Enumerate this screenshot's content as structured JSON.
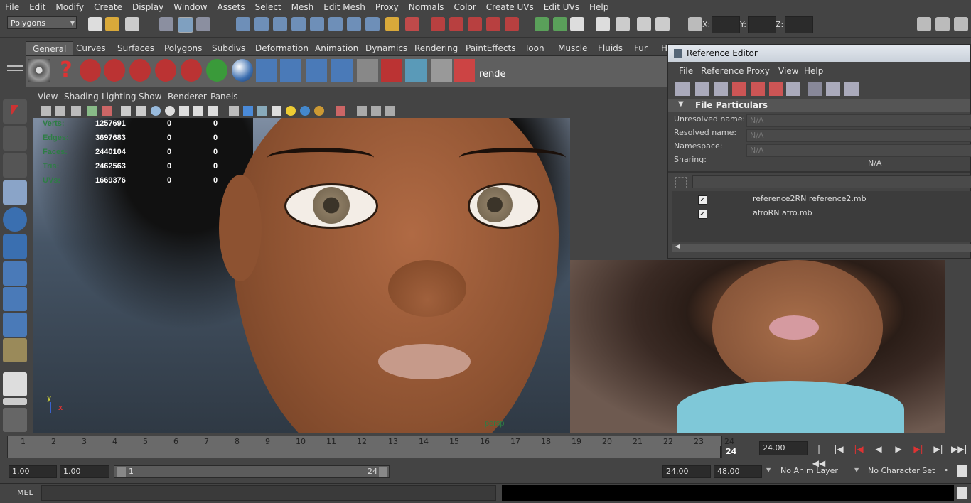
{
  "menubar": {
    "items": [
      "File",
      "Edit",
      "Modify",
      "Create",
      "Display",
      "Window",
      "Assets",
      "Select",
      "Mesh",
      "Edit Mesh",
      "Proxy",
      "Normals",
      "Color",
      "Create UVs",
      "Edit UVs",
      "Help"
    ]
  },
  "statusline": {
    "mode": "Polygons",
    "x_label": "X:",
    "y_label": "Y:",
    "z_label": "Z:"
  },
  "shelf": {
    "tabs": [
      "General",
      "Curves",
      "Surfaces",
      "Polygons",
      "Subdivs",
      "Deformation",
      "Animation",
      "Dynamics",
      "Rendering",
      "PaintEffects",
      "Toon",
      "Muscle",
      "Fluids",
      "Fur",
      "H"
    ],
    "active_tab": "General",
    "render_label": "rende"
  },
  "viewport": {
    "menu": [
      "View",
      "Shading",
      "Lighting",
      "Show",
      "Renderer",
      "Panels"
    ],
    "hud": [
      {
        "label": "Verts:",
        "values": [
          "1257691",
          "0",
          "0"
        ]
      },
      {
        "label": "Edges:",
        "values": [
          "3697683",
          "0",
          "0"
        ]
      },
      {
        "label": "Faces:",
        "values": [
          "2440104",
          "0",
          "0"
        ]
      },
      {
        "label": "Tris:",
        "values": [
          "2462563",
          "0",
          "0"
        ]
      },
      {
        "label": "UVs:",
        "values": [
          "1669376",
          "0",
          "0"
        ]
      }
    ],
    "camera": "persp",
    "axis_y": "y",
    "axis_x": "x"
  },
  "reference_editor": {
    "title": "Reference Editor",
    "menu": [
      "File",
      "Reference",
      "Proxy",
      "View",
      "Help"
    ],
    "section": "File Particulars",
    "fields": [
      {
        "label": "Unresolved name:",
        "value": "N/A"
      },
      {
        "label": "Resolved name:",
        "value": "N/A"
      },
      {
        "label": "Namespace:",
        "value": "N/A"
      }
    ],
    "sharing_label": "Sharing:",
    "sharing_value": "N/A",
    "references": [
      {
        "name": "reference2RN reference2.mb",
        "checked": true
      },
      {
        "name": "afroRN afro.mb",
        "checked": true
      }
    ]
  },
  "timeline": {
    "ticks": [
      "1",
      "2",
      "3",
      "4",
      "5",
      "6",
      "7",
      "8",
      "9",
      "10",
      "11",
      "12",
      "13",
      "14",
      "15",
      "16",
      "17",
      "18",
      "19",
      "20",
      "21",
      "22",
      "23",
      "24"
    ],
    "current": "24",
    "current_field": "24.00"
  },
  "range": {
    "start": "1.00",
    "start2": "1.00",
    "slider_start": "1",
    "slider_end": "24",
    "end": "24.00",
    "end2": "48.00",
    "anim_layer": "No Anim Layer",
    "char_set": "No Character Set"
  },
  "command": {
    "label": "MEL"
  },
  "colors": {
    "accent_red": "#c0392b",
    "hud_green": "#2e7d45",
    "timeline_marker": "#3a3a3a"
  }
}
